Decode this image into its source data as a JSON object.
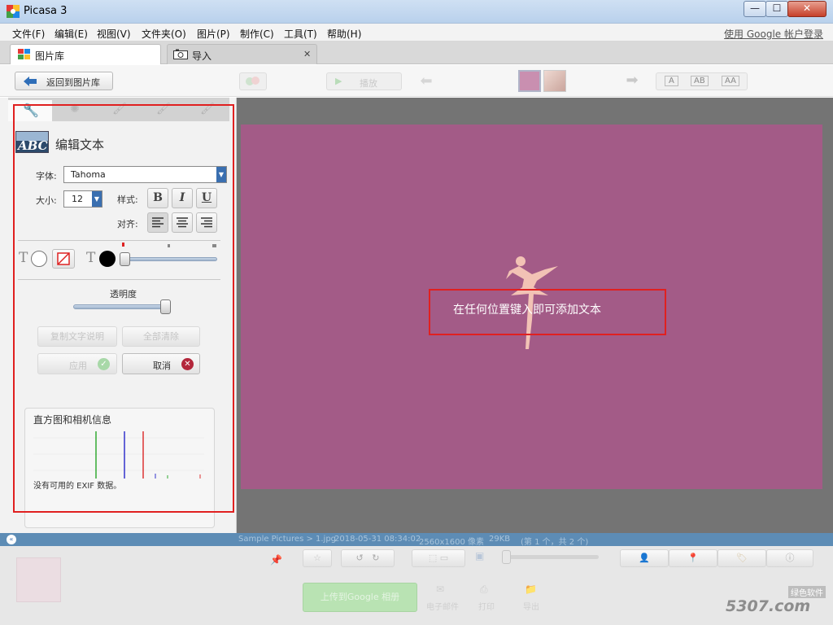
{
  "window": {
    "title": "Picasa 3",
    "minimize": "—",
    "maximize": "☐",
    "close": "✕"
  },
  "menu": {
    "items": [
      "文件(F)",
      "编辑(E)",
      "视图(V)",
      "文件夹(O)",
      "图片(P)",
      "制作(C)",
      "工具(T)",
      "帮助(H)"
    ],
    "login": "使用 Google 帐户登录"
  },
  "tabs": [
    {
      "label": "图片库"
    },
    {
      "label": "导入"
    }
  ],
  "toolbar": {
    "back_label": "返回到图片库",
    "play_label": "播放",
    "caption_modes": [
      "A",
      "AB",
      "AA"
    ]
  },
  "editor": {
    "title": "编辑文本",
    "font_label": "字体:",
    "font_value": "Tahoma",
    "size_label": "大小:",
    "size_value": "12",
    "style_label": "样式:",
    "style_bold": "B",
    "style_italic": "I",
    "style_underline": "U",
    "align_label": "对齐:",
    "transparency_label": "透明度",
    "copy_caption": "复制文字说明",
    "clear_all": "全部清除",
    "apply": "应用",
    "cancel": "取消"
  },
  "histogram": {
    "title": "直方图和相机信息",
    "no_exif": "没有可用的 EXIF 数据。"
  },
  "photo": {
    "prompt": "在任何位置键入即可添加文本",
    "background": "#a35b87",
    "dancer_color": "#f2c2b5"
  },
  "status": {
    "path": "Sample Pictures > 1.jpg",
    "date": "2018-05-31 08:34:02",
    "dims": "2560x1600 像素",
    "size": "29KB",
    "index": "(第 1 个，共 2 个)"
  },
  "bottom": {
    "upload": "上传到Google 相册",
    "email": "电子邮件",
    "print": "打印",
    "export": "导出"
  },
  "watermark": {
    "site": "5307.com",
    "tag": "绿色软件"
  },
  "colors": {
    "accent": "#2f6eb8",
    "highlight": "#e02020"
  }
}
